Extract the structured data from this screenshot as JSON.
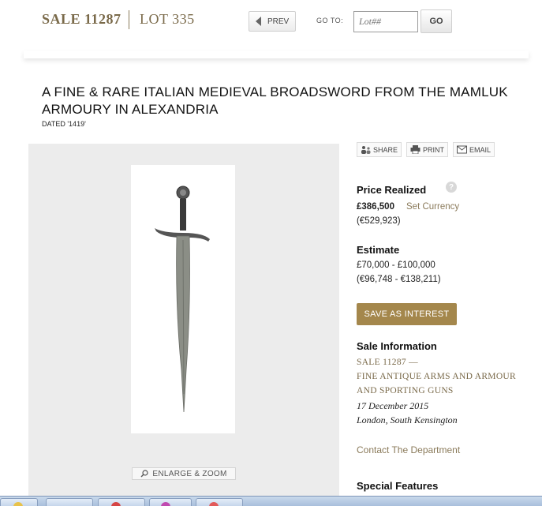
{
  "header": {
    "sale_label": "SALE 11287",
    "lot_label": "LOT 335",
    "prev_label": "PREV",
    "goto_label": "GO TO:",
    "lot_input_placeholder": "Lot##",
    "go_label": "GO"
  },
  "lot": {
    "title": "A FINE & RARE ITALIAN MEDIEVAL BROADSWORD FROM THE MAMLUK ARMOURY IN ALEXANDRIA",
    "dated": "DATED '1419'"
  },
  "image": {
    "enlarge_label": "ENLARGE & ZOOM"
  },
  "share": {
    "share_label": "SHARE",
    "print_label": "PRINT",
    "email_label": "EMAIL"
  },
  "price": {
    "heading": "Price Realized",
    "help": "?",
    "amount": "£386,500",
    "set_currency": "Set Currency",
    "converted": "(€529,923)"
  },
  "estimate": {
    "heading": "Estimate",
    "range": "£70,000 - £100,000",
    "converted": "(€96,748 - €138,211)"
  },
  "save_interest_label": "SAVE AS INTEREST",
  "sale_info": {
    "heading": "Sale Information",
    "sale_line": "SALE 11287 —",
    "name_line_1": "FINE ANTIQUE ARMS AND ARMOUR",
    "name_line_2": "AND SPORTING GUNS",
    "date": "17 December 2015",
    "location": "London, South Kensington"
  },
  "contact_label": "Contact The Department",
  "special_features_heading": "Special Features",
  "colors": {
    "accent_gold": "#a4874c",
    "link_gold": "#8a7a5a"
  }
}
